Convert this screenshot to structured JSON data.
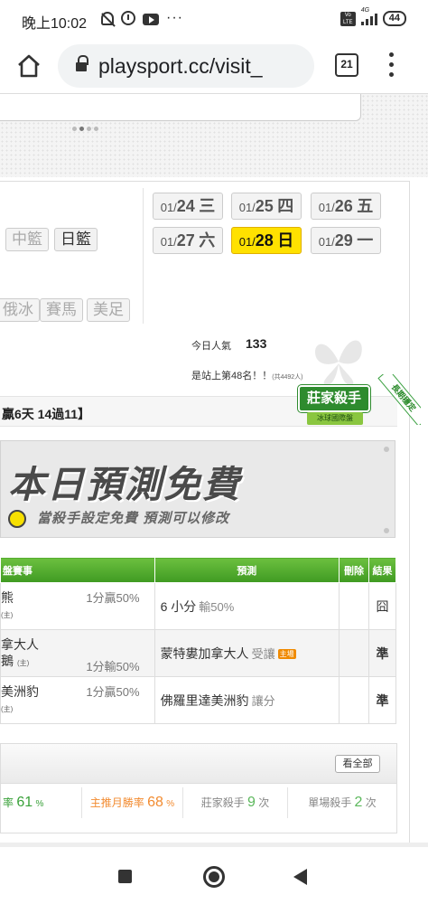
{
  "status_bar": {
    "time": "晚上10:02",
    "more": "···",
    "volte": "Vo LTE",
    "network": "4G",
    "battery": "44"
  },
  "browser": {
    "url": "playsport.cc/visit_",
    "tab_count": "21"
  },
  "sports": {
    "row1": [
      "中籃",
      "日籃"
    ],
    "row2": [
      "俄冰",
      "賽馬",
      "美足"
    ],
    "active": "日籃"
  },
  "dates": [
    {
      "md": "01/",
      "num": "24",
      "day": "三",
      "selected": false
    },
    {
      "md": "01/",
      "num": "25",
      "day": "四",
      "selected": false
    },
    {
      "md": "01/",
      "num": "26",
      "day": "五",
      "selected": false
    },
    {
      "md": "01/",
      "num": "27",
      "day": "六",
      "selected": false
    },
    {
      "md": "01/",
      "num": "28",
      "day": "日",
      "selected": true
    },
    {
      "md": "01/",
      "num": "29",
      "day": "一",
      "selected": false
    }
  ],
  "popularity": {
    "label": "今日人氣",
    "value": "133",
    "rank_text": "是站上第48名！！",
    "rank_total": "(共4492人)"
  },
  "record": {
    "text": "贏6天 14過11】"
  },
  "badge": {
    "title": "莊家殺手",
    "subtitle": "冰球國際盤",
    "ribbon": "長期穩定"
  },
  "free_banner": {
    "title": "本日預測免費",
    "subtitle": "當殺手設定免費  預測可以修改"
  },
  "table": {
    "headers": [
      "盤賽事",
      "預測",
      "刪除",
      "結果"
    ],
    "rows": [
      {
        "event_line1": "熊",
        "event_line2": "",
        "host": "(主)",
        "odds": "1分贏50%",
        "prediction": "6 小分",
        "prediction_extra": "輸50%",
        "host_tag": "",
        "result": "囧",
        "result_ok": false
      },
      {
        "event_line1": "拿大人",
        "event_line2": "鵝",
        "host": "(主)",
        "odds": "1分輸50%",
        "prediction": "蒙特婁加拿大人",
        "prediction_extra": "受讓",
        "host_tag": "主場",
        "result": "準",
        "result_ok": true
      },
      {
        "event_line1": "美洲豹",
        "event_line2": "",
        "host": "(主)",
        "odds": "1分贏50%",
        "prediction": "佛羅里達美洲豹",
        "prediction_extra": "讓分",
        "host_tag": "",
        "result": "準",
        "result_ok": true
      }
    ]
  },
  "stats": {
    "see_all": "看全部",
    "cells": [
      {
        "label": "率",
        "value": "61",
        "unit": "%"
      },
      {
        "label": "主推月勝率",
        "value": "68",
        "unit": "%"
      },
      {
        "label": "莊家殺手",
        "value": "9",
        "unit": "次"
      },
      {
        "label": "單場殺手",
        "value": "2",
        "unit": "次"
      }
    ]
  },
  "colors": {
    "header_green": "#4fae2a",
    "selected_date": "#ffe100",
    "result_green": "#2a9a2a",
    "stat_orange": "#f28b30"
  }
}
